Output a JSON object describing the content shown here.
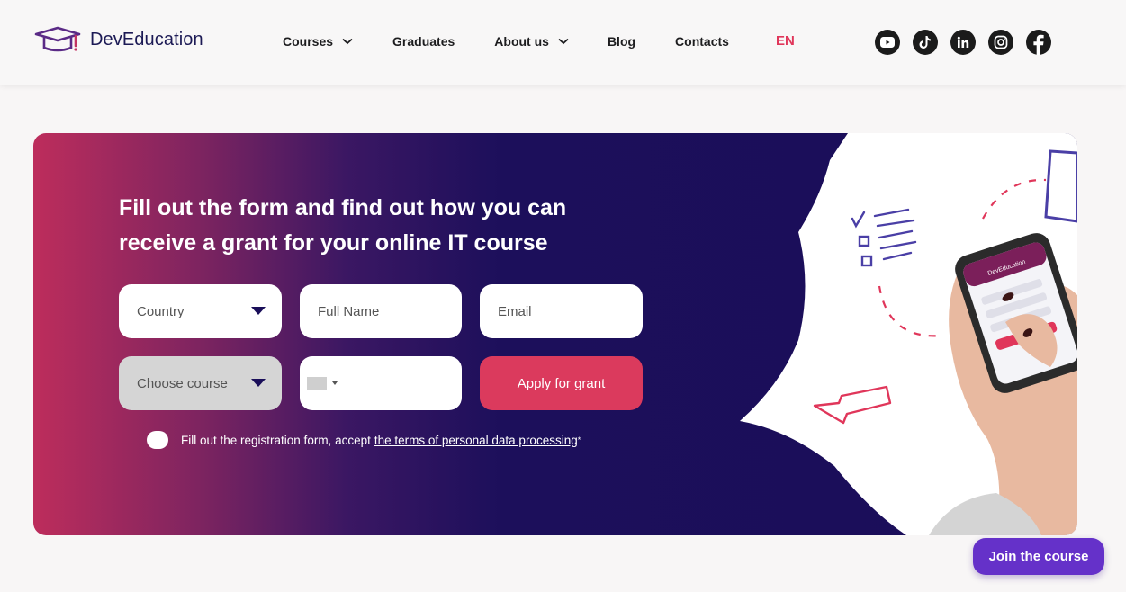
{
  "brand": {
    "name": "DevEducation",
    "logo_color": "#1c1a55",
    "accent": "#e0365a"
  },
  "nav": {
    "items": [
      {
        "label": "Courses",
        "has_dropdown": true
      },
      {
        "label": "Graduates",
        "has_dropdown": false
      },
      {
        "label": "About us",
        "has_dropdown": true
      },
      {
        "label": "Blog",
        "has_dropdown": false
      },
      {
        "label": "Contacts",
        "has_dropdown": false
      }
    ],
    "language": "EN"
  },
  "socials": [
    "youtube-icon",
    "tiktok-icon",
    "linkedin-icon",
    "instagram-icon",
    "facebook-icon"
  ],
  "hero": {
    "title": "Fill out the form and find out how you can receive a grant for your online IT course",
    "form": {
      "country_placeholder": "Country",
      "fullname_placeholder": "Full Name",
      "email_placeholder": "Email",
      "course_placeholder": "Choose course",
      "phone_value": "",
      "submit_label": "Apply for grant"
    },
    "consent": {
      "text": "Fill out the registration form, accept",
      "link": "the terms of personal data processing",
      "required_mark": "*"
    },
    "illustration": {
      "phone_brand": "DevEducation"
    }
  },
  "floating": {
    "join_label": "Join the course"
  },
  "colors": {
    "button_primary": "#db3a5d",
    "join_button": "#6531c9",
    "hero_dark": "#1a0e59"
  }
}
